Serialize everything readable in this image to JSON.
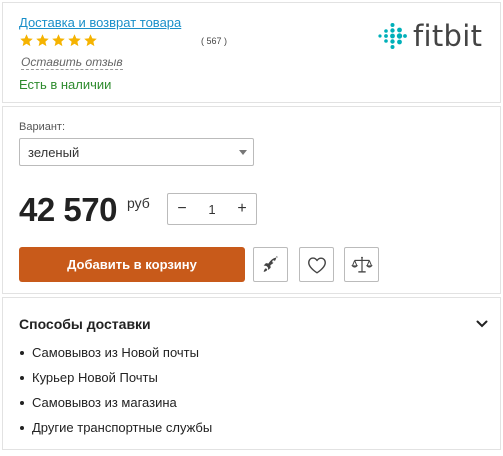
{
  "top": {
    "delivery_link": "Доставка и возврат товара",
    "rating": 5,
    "review_count": "( 567 )",
    "write_review": "Оставить отзыв",
    "stock_status": "Есть в наличии",
    "brand": "fitbit",
    "colors": {
      "link": "#1a8fc9",
      "stars": "#f5b301",
      "stock": "#2e8b2e",
      "logo_dots": "#00b0b9"
    }
  },
  "purchase": {
    "variant_label": "Вариант:",
    "variant_value": "зеленый",
    "price": "42 570",
    "currency": "руб",
    "qty_minus": "−",
    "qty_value": "1",
    "qty_plus": "+",
    "add_to_cart": "Добавить в корзину",
    "colors": {
      "cart_button": "#c85a1a"
    },
    "icons": [
      "rocket-icon",
      "heart-icon",
      "scales-icon"
    ]
  },
  "delivery": {
    "title": "Способы доставки",
    "items": [
      "Самовывоз из Новой почты",
      "Курьер Новой Почты",
      "Самовывоз из магазина",
      "Другие транспортные службы"
    ]
  }
}
